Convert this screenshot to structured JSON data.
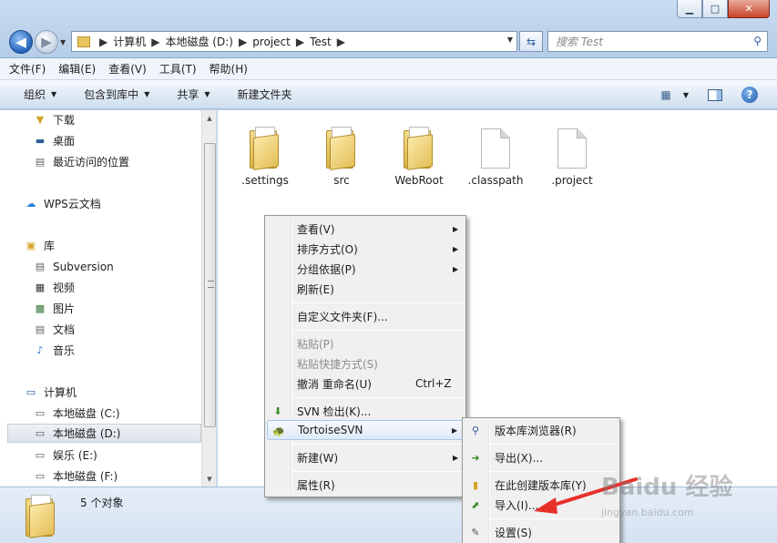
{
  "window": {
    "minimize": "▁",
    "maximize": "□",
    "close": "✕"
  },
  "address": {
    "crumbs": [
      "计算机",
      "本地磁盘 (D:)",
      "project",
      "Test"
    ]
  },
  "search": {
    "placeholder": "搜索 Test"
  },
  "menubar": {
    "items": [
      "文件(F)",
      "编辑(E)",
      "查看(V)",
      "工具(T)",
      "帮助(H)"
    ]
  },
  "toolbar": {
    "organize": "组织",
    "include_in_library": "包含到库中",
    "share": "共享",
    "new_folder": "新建文件夹"
  },
  "navpane": {
    "items": [
      {
        "label": "下载",
        "icon": "download-folder-icon"
      },
      {
        "label": "桌面",
        "icon": "desktop-icon"
      },
      {
        "label": "最近访问的位置",
        "icon": "recent-places-icon"
      },
      {
        "label": "WPS云文档",
        "icon": "cloud-icon"
      },
      {
        "label": "库",
        "icon": "libraries-icon"
      },
      {
        "label": "Subversion",
        "icon": "document-library-icon"
      },
      {
        "label": "视频",
        "icon": "video-library-icon"
      },
      {
        "label": "图片",
        "icon": "picture-library-icon"
      },
      {
        "label": "文档",
        "icon": "document-library-icon"
      },
      {
        "label": "音乐",
        "icon": "music-library-icon"
      },
      {
        "label": "计算机",
        "icon": "computer-icon"
      },
      {
        "label": "本地磁盘 (C:)",
        "icon": "system-drive-icon"
      },
      {
        "label": "本地磁盘 (D:)",
        "icon": "drive-icon"
      },
      {
        "label": "娱乐 (E:)",
        "icon": "drive-icon"
      },
      {
        "label": "本地磁盘 (F:)",
        "icon": "drive-icon"
      }
    ],
    "selected": "本地磁盘 (D:)"
  },
  "files": [
    {
      "name": ".settings",
      "type": "folder"
    },
    {
      "name": "src",
      "type": "folder"
    },
    {
      "name": "WebRoot",
      "type": "folder"
    },
    {
      "name": ".classpath",
      "type": "file"
    },
    {
      "name": ".project",
      "type": "file"
    }
  ],
  "status": {
    "count_text": "5 个对象"
  },
  "context_menu": {
    "items": [
      {
        "label": "查看(V)",
        "submenu": true
      },
      {
        "label": "排序方式(O)",
        "submenu": true
      },
      {
        "label": "分组依据(P)",
        "submenu": true
      },
      {
        "label": "刷新(E)"
      },
      {
        "label": "自定义文件夹(F)..."
      },
      {
        "label": "粘贴(P)",
        "disabled": true
      },
      {
        "label": "粘贴快捷方式(S)",
        "disabled": true
      },
      {
        "label": "撤消 重命名(U)",
        "shortcut": "Ctrl+Z"
      },
      {
        "label": "SVN 检出(K)...",
        "icon": "svn-checkout-icon"
      },
      {
        "label": "TortoiseSVN",
        "icon": "tortoisesvn-icon",
        "submenu": true,
        "highlighted": true
      },
      {
        "label": "新建(W)",
        "submenu": true
      },
      {
        "label": "属性(R)"
      }
    ]
  },
  "svn_submenu": {
    "items": [
      {
        "label": "版本库浏览器(R)",
        "icon": "repo-browser-icon"
      },
      {
        "label": "导出(X)...",
        "icon": "export-icon"
      },
      {
        "label": "在此创建版本库(Y)",
        "icon": "create-repo-icon"
      },
      {
        "label": "导入(I)...",
        "icon": "import-icon"
      },
      {
        "label": "设置(S)",
        "icon": "settings-icon"
      }
    ]
  },
  "watermark": {
    "main": "Baidu 经验",
    "sub": "jingyan.baidu.com"
  },
  "colors": {
    "accent": "#2563b8",
    "annotation_arrow": "#e8302a"
  }
}
